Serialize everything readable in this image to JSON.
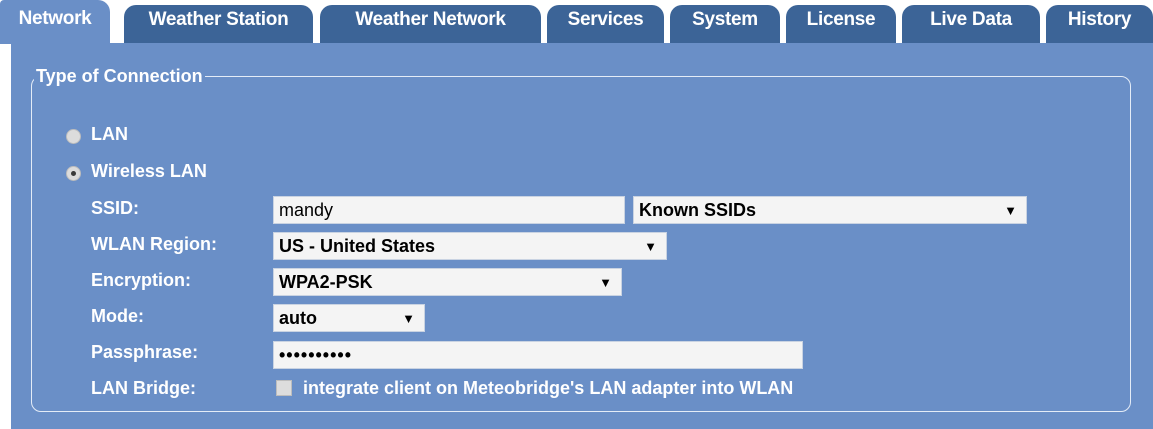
{
  "tabs": [
    {
      "label": "Network",
      "active": true
    },
    {
      "label": "Weather Station",
      "active": false
    },
    {
      "label": "Weather Network",
      "active": false
    },
    {
      "label": "Services",
      "active": false
    },
    {
      "label": "System",
      "active": false
    },
    {
      "label": "License",
      "active": false
    },
    {
      "label": "Live Data",
      "active": false
    },
    {
      "label": "History",
      "active": false
    }
  ],
  "connection": {
    "legend": "Type of Connection",
    "options": [
      {
        "label": "LAN",
        "selected": false
      },
      {
        "label": "Wireless LAN",
        "selected": true
      }
    ]
  },
  "form": {
    "ssid": {
      "label": "SSID:",
      "value": "mandy",
      "known_label": "Known SSIDs"
    },
    "region": {
      "label": "WLAN Region:",
      "value": "US - United States"
    },
    "encryption": {
      "label": "Encryption:",
      "value": "WPA2-PSK"
    },
    "mode": {
      "label": "Mode:",
      "value": "auto"
    },
    "passphrase": {
      "label": "Passphrase:",
      "value": "••••••••••"
    },
    "bridge": {
      "label": "LAN Bridge:",
      "checkbox_label": "integrate client on Meteobridge's LAN adapter into WLAN",
      "checked": false
    }
  },
  "colors": {
    "tab": "#3c6497",
    "panel": "#6a8fc7",
    "text": "#ffffff"
  },
  "icons": {
    "dropdown": "dropdown-arrow-icon"
  }
}
